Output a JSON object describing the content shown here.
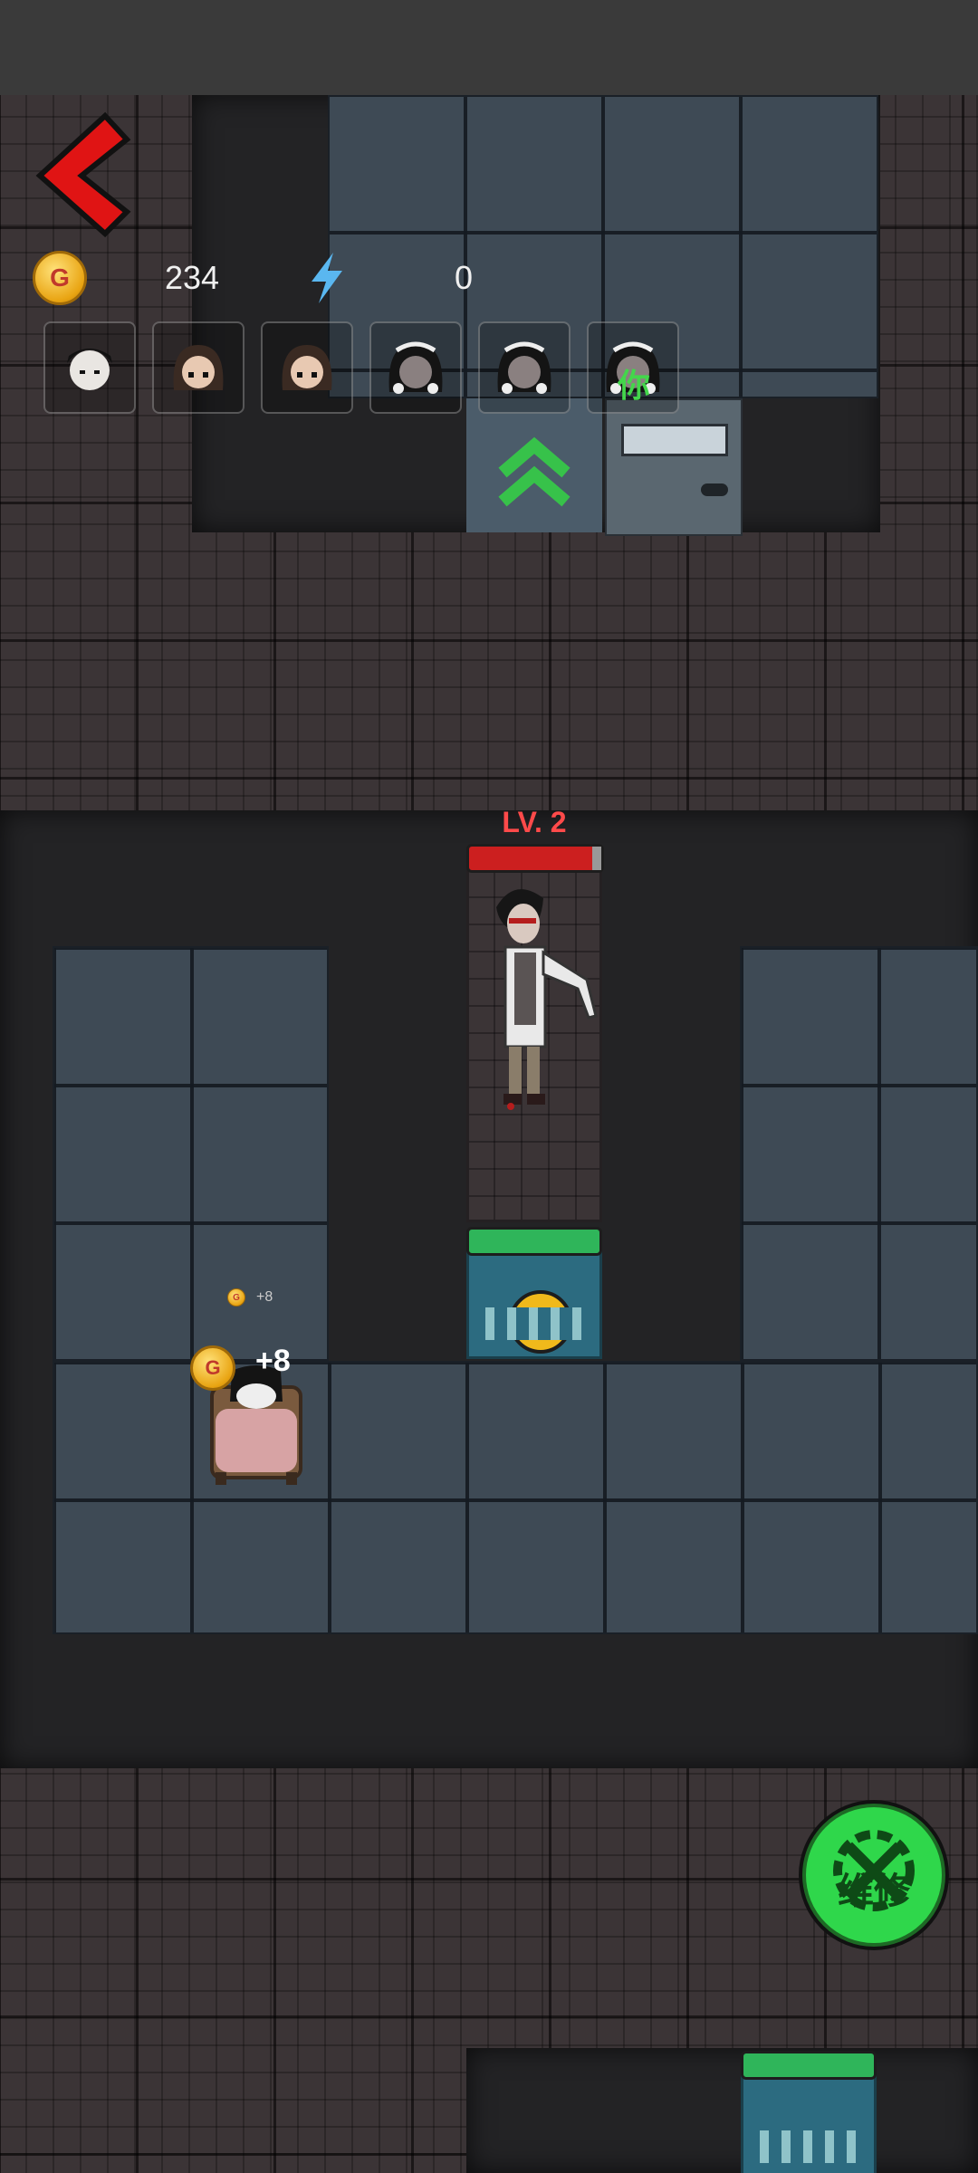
{
  "hud": {
    "gold": "234",
    "energy": "0",
    "coin_glyph": "G"
  },
  "party": [
    {
      "avatar": "boy-avatar"
    },
    {
      "avatar": "girl-brown-avatar"
    },
    {
      "avatar": "girl-brown-avatar"
    },
    {
      "avatar": "maid-girl-avatar"
    },
    {
      "avatar": "maid-girl-avatar"
    },
    {
      "avatar": "maid-girl-avatar",
      "marker": "你"
    }
  ],
  "ghost": {
    "level_label": "LV. 2"
  },
  "bed": {
    "reward_label": "+8",
    "small_reward_label": "+8"
  },
  "repair_button": {
    "label": "维修"
  },
  "colors": {
    "accent_green": "#2fd74b",
    "danger_red": "#cc1f1f",
    "gold": "#e9a412"
  }
}
